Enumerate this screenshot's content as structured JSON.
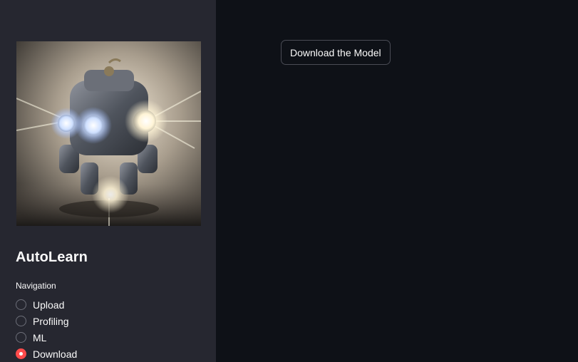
{
  "sidebar": {
    "image_alt": "robot-illustration",
    "title": "AutoLearn",
    "nav_label": "Navigation",
    "nav_options": [
      {
        "label": "Upload",
        "selected": false
      },
      {
        "label": "Profiling",
        "selected": false
      },
      {
        "label": "ML",
        "selected": false
      },
      {
        "label": "Download",
        "selected": true
      }
    ]
  },
  "main": {
    "download_button_label": "Download the Model"
  },
  "colors": {
    "background": "#0e1117",
    "sidebar": "#262730",
    "accent": "#ff4b4b",
    "text": "#fafafa"
  }
}
